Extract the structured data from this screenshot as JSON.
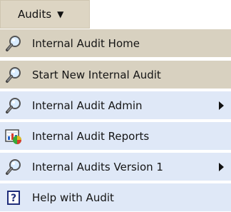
{
  "menu": {
    "trigger_label": "Audits",
    "items": [
      {
        "label": "Internal Audit Home",
        "icon": "key-search-icon",
        "has_submenu": false,
        "state": "highlighted"
      },
      {
        "label": "Start New Internal Audit",
        "icon": "key-search-icon",
        "has_submenu": false,
        "state": "highlighted"
      },
      {
        "label": "Internal Audit Admin",
        "icon": "key-search-icon",
        "has_submenu": true,
        "state": "normal"
      },
      {
        "label": "Internal Audit Reports",
        "icon": "report-chart-icon",
        "has_submenu": false,
        "state": "normal"
      },
      {
        "label": "Internal Audits Version 1",
        "icon": "key-search-icon",
        "has_submenu": true,
        "state": "normal"
      },
      {
        "label": "Help with Audit",
        "icon": "help-icon",
        "has_submenu": false,
        "state": "normal"
      }
    ]
  },
  "colors": {
    "top_button": "#ddd5c3",
    "highlight_item": "#d8d1c0",
    "normal_item": "#dfe8f7",
    "text": "#151515"
  }
}
